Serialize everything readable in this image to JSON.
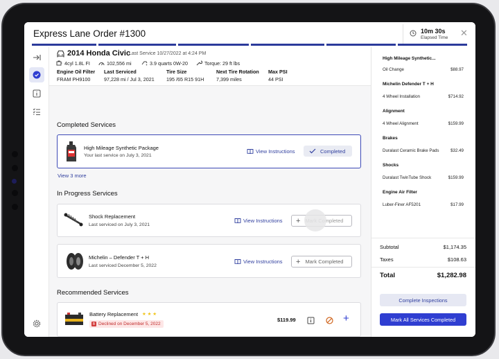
{
  "header": {
    "title": "Express Lane Order #1300",
    "timer_value": "10m 30s",
    "timer_label": "Elapsed Time"
  },
  "vehicle": {
    "name": "2014 Honda Civic",
    "last_service": "Last Service 10/27/2022 at 4:24 PM",
    "engine": "4cyl 1.8L FI",
    "mileage": "102,556 mi",
    "oil": "3.9 quarts 0W-20",
    "torque": "Torque: 29 ft lbs",
    "specs": [
      {
        "label": "Engine Oil Filter",
        "value": "FRAM PH9100"
      },
      {
        "label": "Last Serviced",
        "value": "97,228 mi / Jul 3, 2021"
      },
      {
        "label": "Tire Size",
        "value": "195 /65 R15 91H"
      },
      {
        "label": "Next Tire Rotation",
        "value": "7,399 miles"
      },
      {
        "label": "Max PSI",
        "value": "44 PSI"
      }
    ]
  },
  "completed": {
    "title": "Completed Services",
    "item": {
      "name": "High Mileage Synthetic Package",
      "sub": "Your last service on July 3, 2021",
      "link": "View Instructions",
      "status": "Completed"
    },
    "more": "View 3 more"
  },
  "in_progress": {
    "title": "In Progress Services",
    "items": [
      {
        "name": "Shock Replacement",
        "sub": "Last serviced on July 3, 2021",
        "link": "View Instructions",
        "button": "Mark Completed"
      },
      {
        "name": "Michelin – Defender T + H",
        "sub": "Last serviced December 5, 2022",
        "link": "View Instructions",
        "button": "Mark Completed"
      }
    ]
  },
  "recommended": {
    "title": "Recommended Services",
    "item": {
      "name": "Battery Replacement",
      "stars": "★ ★ ★",
      "badge": "Declined on December 5, 2022",
      "price": "$119.99"
    }
  },
  "summary": {
    "groups": [
      {
        "title": "High Mileage Synthetic...",
        "item": "Oil Change",
        "price": "$88.97"
      },
      {
        "title": "Michelin Defender T + H",
        "item": "4 Wheel Installation",
        "price": "$714.92"
      },
      {
        "title": "Alignment",
        "item": "4 Wheel Alignment",
        "price": "$159.99"
      },
      {
        "title": "Brakes",
        "item": "Duralast Ceramic Brake Pads",
        "price": "$32.49"
      },
      {
        "title": "Shocks",
        "item": "Duralast TwinTube Shock",
        "price": "$159.99"
      },
      {
        "title": "Engine Air Filter",
        "item": "Luber-Finer AF5201",
        "price": "$17.99"
      }
    ],
    "subtotal_label": "Subtotal",
    "subtotal": "$1,174.35",
    "taxes_label": "Taxes",
    "taxes": "$108.63",
    "total_label": "Total",
    "total": "$1,282.98",
    "complete_inspections": "Complete Inspections",
    "mark_all": "Mark All Services Completed"
  },
  "colors": {
    "accent": "#2f3ed1",
    "navy": "#2b3a9b",
    "declined": "#d23a3a",
    "star": "#f0c419"
  }
}
